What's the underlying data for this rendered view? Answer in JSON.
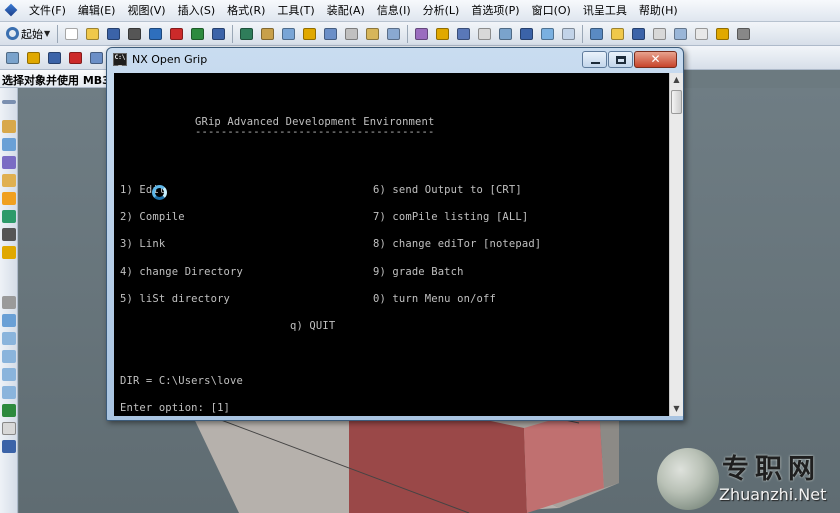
{
  "menubar": {
    "items": [
      "文件(F)",
      "编辑(E)",
      "视图(V)",
      "插入(S)",
      "格式(R)",
      "工具(T)",
      "装配(A)",
      "信息(I)",
      "分析(L)",
      "首选项(P)",
      "窗口(O)",
      "讯呈工具",
      "帮助(H)"
    ]
  },
  "toolbar": {
    "start_label": "起始",
    "toolbar1_icon_colors": [
      "#ffffff",
      "#f0c84a",
      "#3b63a8",
      "#555555",
      "#2e6fbd",
      "#cc2a2a",
      "#2d8a3e",
      "#3b63a8",
      "#2f7d5a",
      "#c8a04a",
      "#79a5d6",
      "#e0a800",
      "#6b8fc7",
      "#c0c0c0",
      "#d7b65a",
      "#8aa9d1",
      "#9a6dbf",
      "#e0a800",
      "#5a78b8",
      "#d8d8d8",
      "#7aa3cc",
      "#3b63a8",
      "#7ab0e0",
      "#c2d3e8",
      "#5a8ac2",
      "#f0c84a",
      "#3b63a8",
      "#d8d8d8",
      "#9ab6d8",
      "#e8e8e8",
      "#e0a800",
      "#888888"
    ],
    "toolbar2_icon_colors": [
      "#7aa3cc",
      "#e0a800",
      "#3b63a8",
      "#cc2a2a",
      "#6b8fc7",
      "#79a5d6",
      "#d8d8d8",
      "#c8a04a",
      "#e0a800",
      "#2d8a3e",
      "#5a78b8",
      "#cc2a2a"
    ]
  },
  "selection_bar": {
    "label": "选择对象并使用 MB3 ,"
  },
  "grip_window": {
    "title": "NX Open Grip",
    "console": {
      "heading": "GRip Advanced Development Environment",
      "underline": "-------------------------------------",
      "left_options": [
        "1) Edit",
        "2) Compile",
        "3) Link",
        "4) change Directory",
        "5) liSt directory"
      ],
      "right_options": [
        "6) send Output to [CRT]",
        "7) comPile listing [ALL]",
        "8) change ediTor [notepad]",
        "9) grade Batch",
        "0) turn Menu on/off"
      ],
      "quit_option": "q) QUIT",
      "dir_line": "DIR = C:\\Users\\love",
      "prompt_line": "Enter option: [1]"
    }
  },
  "watermark": {
    "chinese": "专职网",
    "english": "Zhuanzhi.Net"
  },
  "colors": {
    "console_bg": "#000000",
    "console_text": "#c0c0c0",
    "viewport": "#6c7a80",
    "block": "#a85b5b"
  }
}
